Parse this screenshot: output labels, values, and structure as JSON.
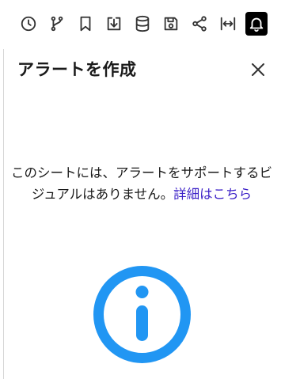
{
  "toolbar": {
    "icons": [
      "clock-icon",
      "branch-icon",
      "bookmark-icon",
      "download-icon",
      "database-icon",
      "save-icon",
      "share-icon",
      "fit-width-icon",
      "bell-icon"
    ],
    "active": "bell-icon"
  },
  "panel": {
    "title": "アラートを作成",
    "message_text": "このシートには、アラートをサポートするビジュアルはありません。",
    "message_link": "詳細はこちら"
  },
  "colors": {
    "accent": "#2196f3",
    "link": "#3a1fc7",
    "active_bg": "#000000"
  }
}
